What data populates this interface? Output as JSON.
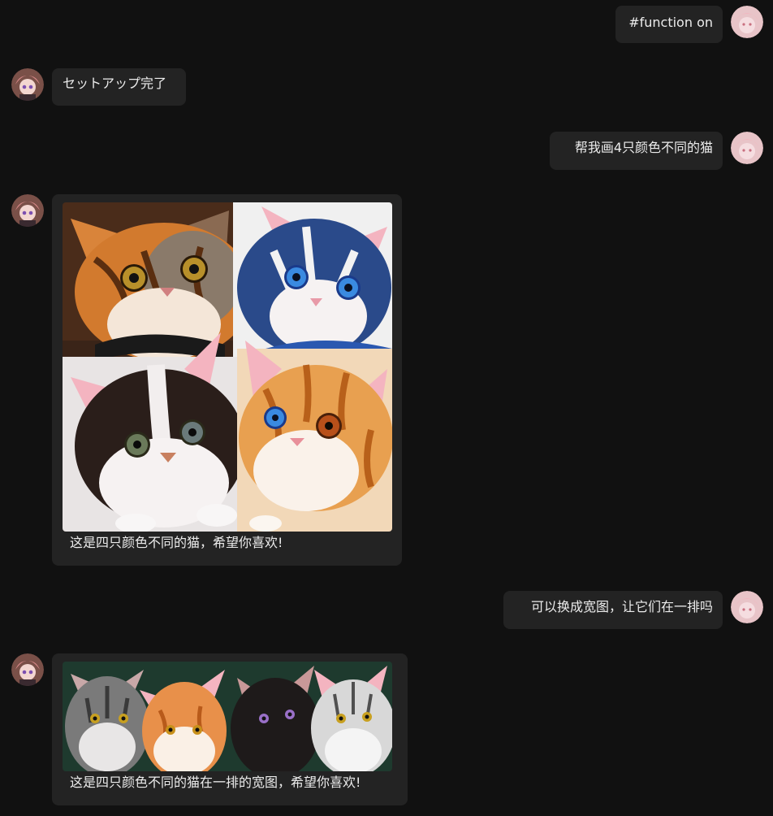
{
  "messages": [
    {
      "role": "user",
      "text": "#function on"
    },
    {
      "role": "assistant",
      "text": "セットアップ完了"
    },
    {
      "role": "user",
      "text": "帮我画4只颜色不同的猫"
    },
    {
      "role": "assistant",
      "image_alt": "four cats of different colors: tabby, blue, black-white, orange",
      "caption": "这是四只颜色不同的猫，希望你喜欢!"
    },
    {
      "role": "user",
      "text": "可以换成宽图，让它们在一排吗"
    },
    {
      "role": "assistant",
      "image_alt": "four cats in a row: gray tabby, orange, black, silver tabby",
      "caption": "这是四只颜色不同的猫在一排的宽图，希望你喜欢!"
    }
  ],
  "avatars": {
    "user": "user-avatar",
    "assistant": "assistant-avatar"
  },
  "colors": {
    "background": "#111111",
    "bubble": "#232323",
    "text": "#ececec"
  }
}
